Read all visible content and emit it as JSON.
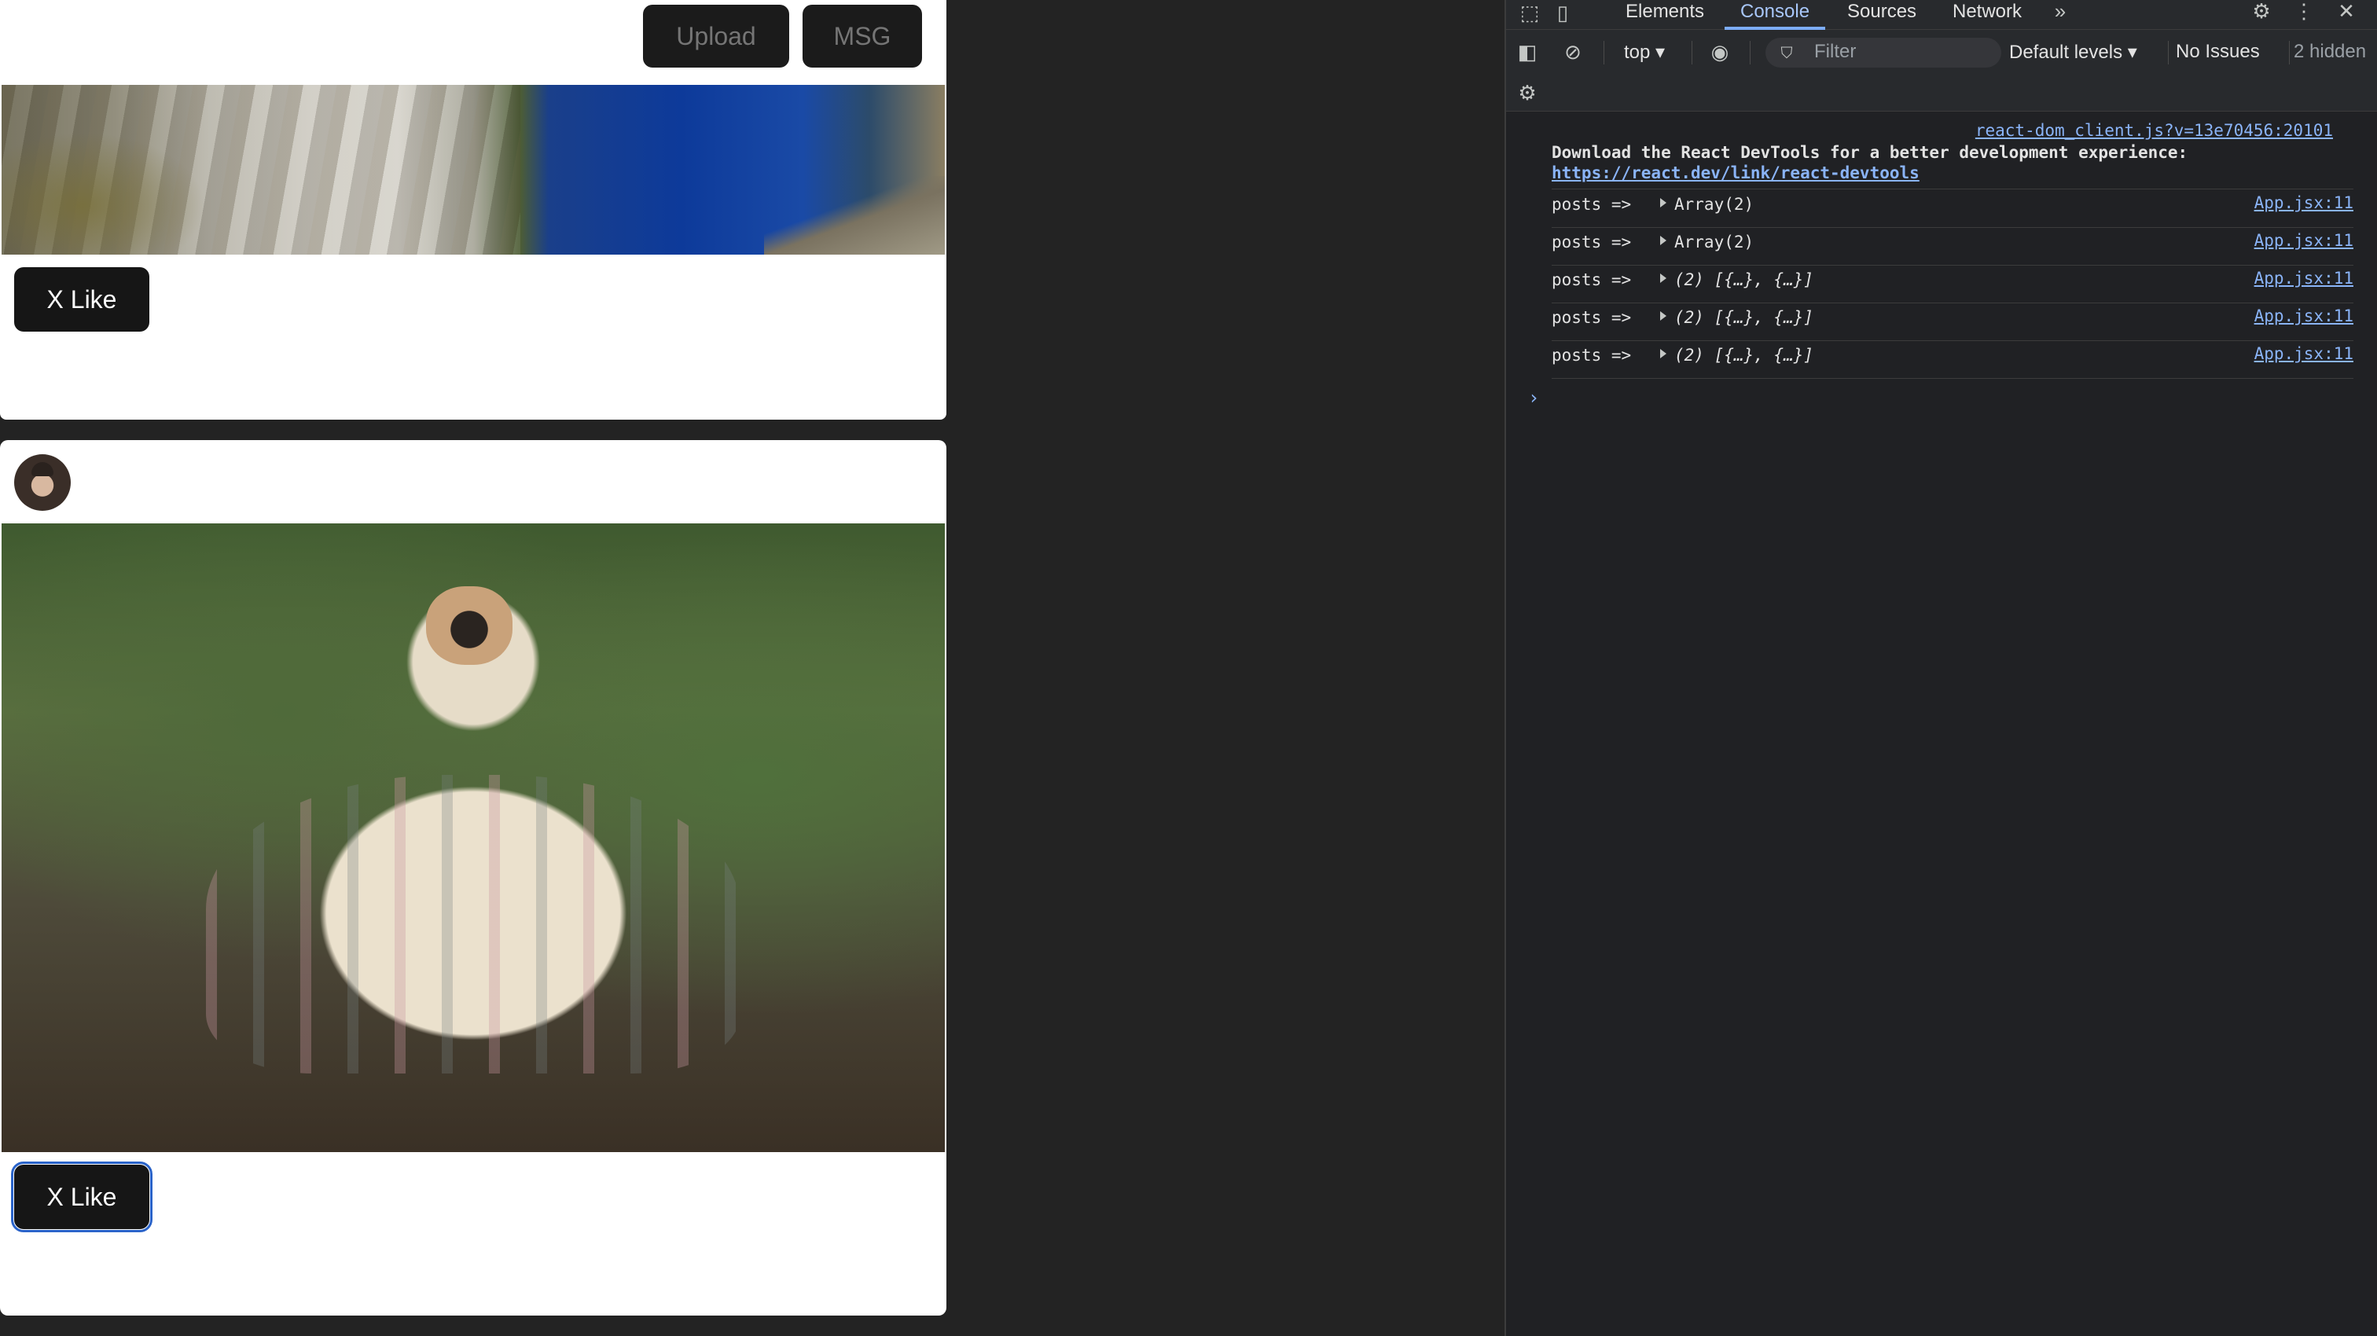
{
  "app": {
    "upload_label": "Upload",
    "msg_label": "MSG",
    "like_label": "X Like"
  },
  "devtools": {
    "tabs": [
      "Elements",
      "Console",
      "Sources",
      "Network"
    ],
    "context": "top",
    "filter_placeholder": "Filter",
    "levels": "Default levels",
    "issues": "No Issues",
    "hidden": "2 hidden",
    "intro": {
      "source": "react-dom_client.js?v=13e70456:20101",
      "message": "Download the React DevTools for a better development experience:",
      "link": "https://react.dev/link/react-devtools"
    },
    "logs": [
      {
        "label": "posts =>",
        "value": "Array(2)",
        "source": "App.jsx:11"
      },
      {
        "label": "posts =>",
        "value": "Array(2)",
        "source": "App.jsx:11"
      },
      {
        "label": "posts =>",
        "value": "(2) [{…}, {…}]",
        "source": "App.jsx:11"
      },
      {
        "label": "posts =>",
        "value": "(2) [{…}, {…}]",
        "source": "App.jsx:11"
      },
      {
        "label": "posts =>",
        "value": "(2) [{…}, {…}]",
        "source": "App.jsx:11"
      }
    ],
    "prompt": "›"
  }
}
